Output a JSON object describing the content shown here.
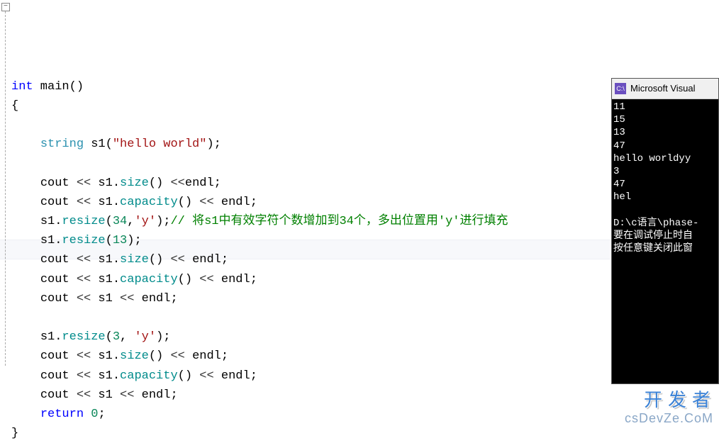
{
  "code": {
    "line1_kw": "int",
    "line1_func": " main",
    "line1_rest": "()",
    "brace_open": "{",
    "l3_type": "string",
    "l3_var": " s1",
    "l3_paren": "(",
    "l3_str": "\"hello world\"",
    "l3_end": ");",
    "l4a": "cout ",
    "l4op": "<<",
    "l4b": " s1",
    "l4dot": ".",
    "l4size": "size",
    "l4c": "() ",
    "l4d": "endl;",
    "l5cap": "capacity",
    "l5c": "() ",
    "l6a": "s1",
    "l6resize": "resize",
    "l6args": "(",
    "l6num": "34",
    "l6comma": ",",
    "l6ch": "'y'",
    "l6end": ");",
    "l6cmt": "// 将s1中有效字符个数增加到34个，多出位置用'y'进行填充",
    "l7num": "13",
    "l7end": ");",
    "l11num": "3",
    "l11sep": ", ",
    "l14_kw": "return",
    "l14_num": " 0",
    "l14_end": ";",
    "brace_close": "}"
  },
  "console": {
    "title": "Microsoft Visual",
    "icon_text": "C:\\",
    "lines": [
      "11",
      "15",
      "13",
      "47",
      "hello worldyy",
      "3",
      "47",
      "hel",
      "",
      "D:\\c语言\\phase-",
      "要在调试停止时自",
      "按任意键关闭此窗"
    ]
  },
  "watermark": {
    "w1": "开发者",
    "w2": "csDevZe.CoM"
  }
}
